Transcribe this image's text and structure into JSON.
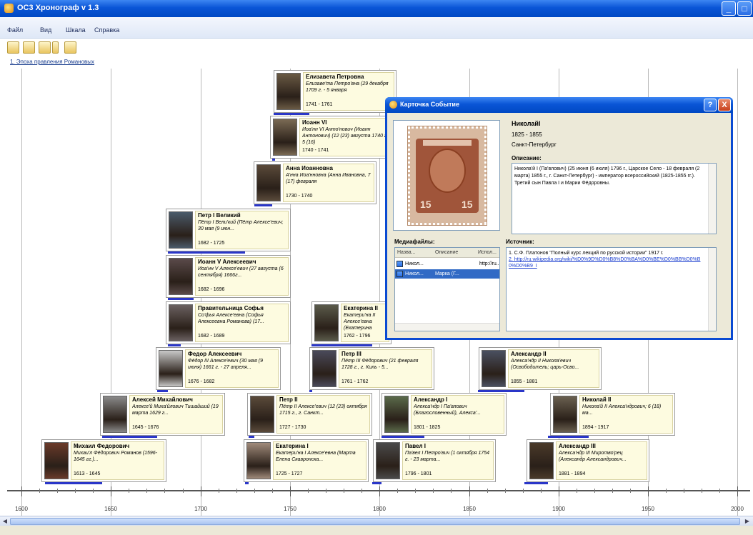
{
  "window": {
    "title": "OC3 Хронограф v 1.3",
    "app_icon": "app-icon",
    "minimize_glyph": "_",
    "maximize_glyph": "□"
  },
  "menu": {
    "items": [
      "Файл",
      "Вид",
      "Шкала",
      "Справка"
    ]
  },
  "toolbar": {
    "buttons": [
      "open-icon",
      "save-icon",
      "add-icon",
      "dropdown-icon",
      "print-icon"
    ]
  },
  "tabs": {
    "active_label": "1. Эпоха правления Романовых"
  },
  "timeline": {
    "axis_labels": [
      "1600",
      "1650",
      "1700",
      "1750",
      "1800",
      "1850",
      "1900",
      "1950",
      "2000"
    ],
    "span_color": "#2a36c8",
    "cards": [
      {
        "name": "Елизавета Петровна",
        "desc": "Елизаве'та Петро'вна (29 декабря 1709 г. - 5 января",
        "years": "1741 - 1761",
        "start": 1741,
        "end": 1761
      },
      {
        "name": "Иоанн VI",
        "desc": "Иоа'нн VI Анто'нович (Иоанн Антонович) (12 (23) августа 1740 г. - 5 (16)",
        "years": "1740 - 1741",
        "start": 1740,
        "end": 1741
      },
      {
        "name": "Анна Иоанновна",
        "desc": "А'нна Иоа'нновна (Анна Ивановна, 7 (17) февраля",
        "years": "1730 - 1740",
        "start": 1730,
        "end": 1740
      },
      {
        "name": "Петр I Великий",
        "desc": "Пётр I Вели'кий (Пётр Алексе'евич; 30 мая (9 июн...",
        "years": "1682 - 1725",
        "start": 1682,
        "end": 1725
      },
      {
        "name": "Иоанн V Алексеевич",
        "desc": "Иоа'нн V Алексе'евич (27 августа (6 сентября) 1666г...",
        "years": "1682 - 1696",
        "start": 1682,
        "end": 1696
      },
      {
        "name": "Правительница Софья",
        "desc": "Со'фья Алексе'евна (Софья Алексеевна Романова) (17...",
        "years": "1682 - 1689",
        "start": 1682,
        "end": 1689
      },
      {
        "name": "Федор Алексеевич",
        "desc": "Фёдор III Алексе'евич (30 мая (9 июня) 1661 г. - 27 апреля...",
        "years": "1676 - 1682",
        "start": 1676,
        "end": 1682
      },
      {
        "name": "Алексей Михайлович",
        "desc": "Алексе'й Миха'йлович Тишайший (19 марта 1629 г...",
        "years": "1645 - 1676",
        "start": 1645,
        "end": 1676
      },
      {
        "name": "Михаил Федорович",
        "desc": "Михаи'л Фёдорович Романов (1596-1645 гг.)...",
        "years": "1613 - 1645",
        "start": 1613,
        "end": 1645
      },
      {
        "name": "Екатерина II",
        "desc": "Екатери'на II Алексе'евна (Екатерина Великая)...",
        "years": "1762 - 1796",
        "start": 1762,
        "end": 1796
      },
      {
        "name": "Петр III",
        "desc": "Пётр III Фёдорович (21 февраля 1728 г., г. Киль - 5...",
        "years": "1761 - 1762",
        "start": 1761,
        "end": 1762
      },
      {
        "name": "Петр II",
        "desc": "Пётр II Алексе'евич (12 (23) октября 1715 г., г. Санкт...",
        "years": "1727 - 1730",
        "start": 1727,
        "end": 1730
      },
      {
        "name": "Екатерина I",
        "desc": "Екатери'на I Алексе'евна (Марта Елена Скавронска...",
        "years": "1725 - 1727",
        "start": 1725,
        "end": 1727
      },
      {
        "name": "Александр I",
        "desc": "Алекса'ндр I Па'влович (Благословенный), Алекса'...",
        "years": "1801 - 1825",
        "start": 1801,
        "end": 1825
      },
      {
        "name": "Павел I",
        "desc": "Па'вел I Петро'вич (1 октября 1754 г. - 23 марта...",
        "years": "1796 - 1801",
        "start": 1796,
        "end": 1801
      },
      {
        "name": "Александр II",
        "desc": "Алекса'ндр II Никола'евич (Освободитель; царь-Осво...",
        "years": "1855 - 1881",
        "start": 1855,
        "end": 1881
      },
      {
        "name": "Николай II",
        "desc": "Никола'й II Алекса'ндрович; 6 (18) ма...",
        "years": "1894 - 1917",
        "start": 1894,
        "end": 1917
      },
      {
        "name": "Александр III",
        "desc": "Алекса'ндр III Миротво'рец (Александр Александрович...",
        "years": "1881 - 1894",
        "start": 1881,
        "end": 1894
      }
    ]
  },
  "dialog": {
    "title": "Карточка Событие",
    "help_glyph": "?",
    "close_glyph": "X",
    "name": "НиколайI",
    "years": "1825 - 1855",
    "place": "Санкт-Петербург",
    "desc_label": "Описание:",
    "description": "Никола'й I (Па'влович) (25 июня (6 июля) 1796 г., Царское Село - 18 февраля (2 марта) 1855 г., г. Санкт-Петербург) - император всероссийский (1825-1855 гг.). Третий сын Павла I и Марии Фёдоровны.",
    "stamp_value": "15",
    "media_label": "Медиафайлы:",
    "media_columns": [
      "Назва...",
      "Описание",
      "Испол..."
    ],
    "media_rows": [
      {
        "name": "Никол...",
        "desc": "",
        "source": "http://ru..."
      },
      {
        "name": "Никол...",
        "desc": "Марка (Г...",
        "source": ""
      }
    ],
    "sources_label": "Источник:",
    "sources_text": "1. С.Ф. Платонов \"Полный курс лекций по русской истории\" 1917 г.",
    "sources_link": "2. http://ru.wikipedia.org/wiki/%D0%9D%D0%B8%D0%BA%D0%BE%D0%BB%D0%B0%D0%B9_I"
  }
}
